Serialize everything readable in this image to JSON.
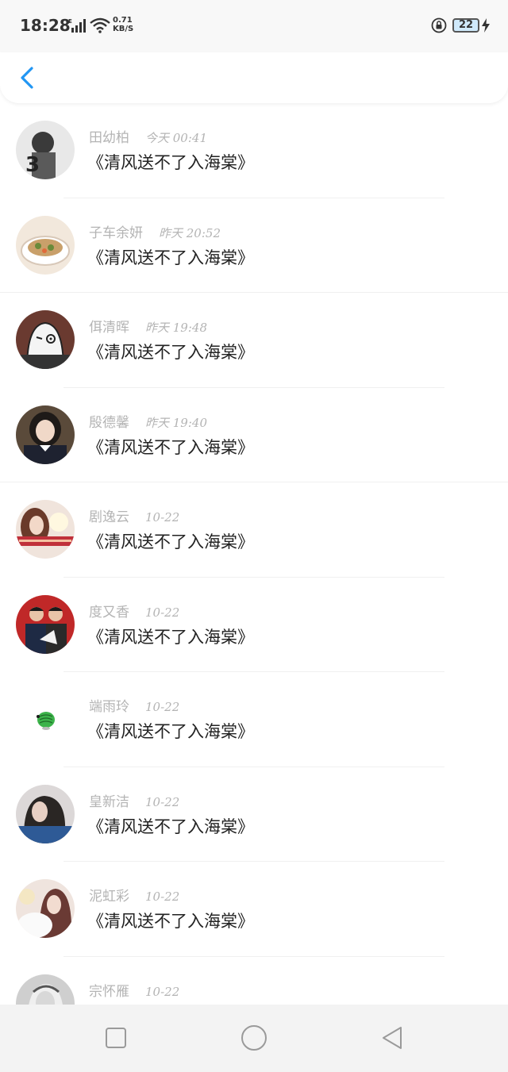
{
  "status_bar": {
    "time": "18:28",
    "net_speed_value": "0.71",
    "net_speed_unit": "KB/S",
    "battery": "22"
  },
  "header": {
    "back_icon": "chevron-left-icon",
    "accent_color": "#2196f3"
  },
  "contacts": [
    {
      "name": "田幼柏",
      "time": "今天 00:41",
      "message": "《清风送不了入海棠》",
      "avatar_color": "#8a8a8a"
    },
    {
      "name": "子车余妍",
      "time": "昨天 20:52",
      "message": "《清风送不了入海棠》",
      "avatar_color": "#c9a06a"
    },
    {
      "name": "佴清晖",
      "time": "昨天 19:48",
      "message": "《清风送不了入海棠》",
      "avatar_color": "#5a3a32"
    },
    {
      "name": "殷德馨",
      "time": "昨天 19:40",
      "message": "《清风送不了入海棠》",
      "avatar_color": "#2a2a2a"
    },
    {
      "name": "剧逸云",
      "time": "10-22",
      "message": "《清风送不了入海棠》",
      "avatar_color": "#d9b2a6"
    },
    {
      "name": "度又香",
      "time": "10-22",
      "message": "《清风送不了入海棠》",
      "avatar_color": "#b52a2a"
    },
    {
      "name": "端雨玲",
      "time": "10-22",
      "message": "《清风送不了入海棠》",
      "avatar_color": "#ffffff"
    },
    {
      "name": "皇新洁",
      "time": "10-22",
      "message": "《清风送不了入海棠》",
      "avatar_color": "#3a6aa6"
    },
    {
      "name": "泥虹彩",
      "time": "10-22",
      "message": "《清风送不了入海棠》",
      "avatar_color": "#e8d6cc"
    },
    {
      "name": "宗怀雁",
      "time": "10-22",
      "message": "",
      "avatar_color": "#9a9a9a"
    }
  ],
  "nav_bar": {
    "recent_icon": "square-icon",
    "home_icon": "circle-icon",
    "back_icon": "triangle-back-icon"
  }
}
